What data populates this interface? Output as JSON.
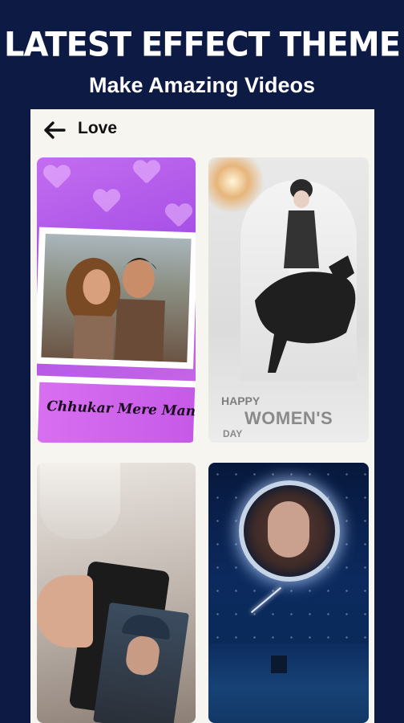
{
  "banner": {
    "headline": "LATEST EFFECT THEME",
    "subline": "Make Amazing Videos"
  },
  "appbar": {
    "back_icon": "arrow-left-icon",
    "title": "Love"
  },
  "cards": [
    {
      "id": "c1",
      "caption": "Chhukar Mere Man"
    },
    {
      "id": "c2",
      "caption_line1": "HAPPY",
      "caption_line2": "WOMEN'S",
      "caption_line3": "DAY"
    },
    {
      "id": "c3"
    },
    {
      "id": "c4"
    }
  ],
  "colors": {
    "page_background": "#0d1a44",
    "panel_background": "#f6f5f0",
    "text_dark": "#111111"
  }
}
